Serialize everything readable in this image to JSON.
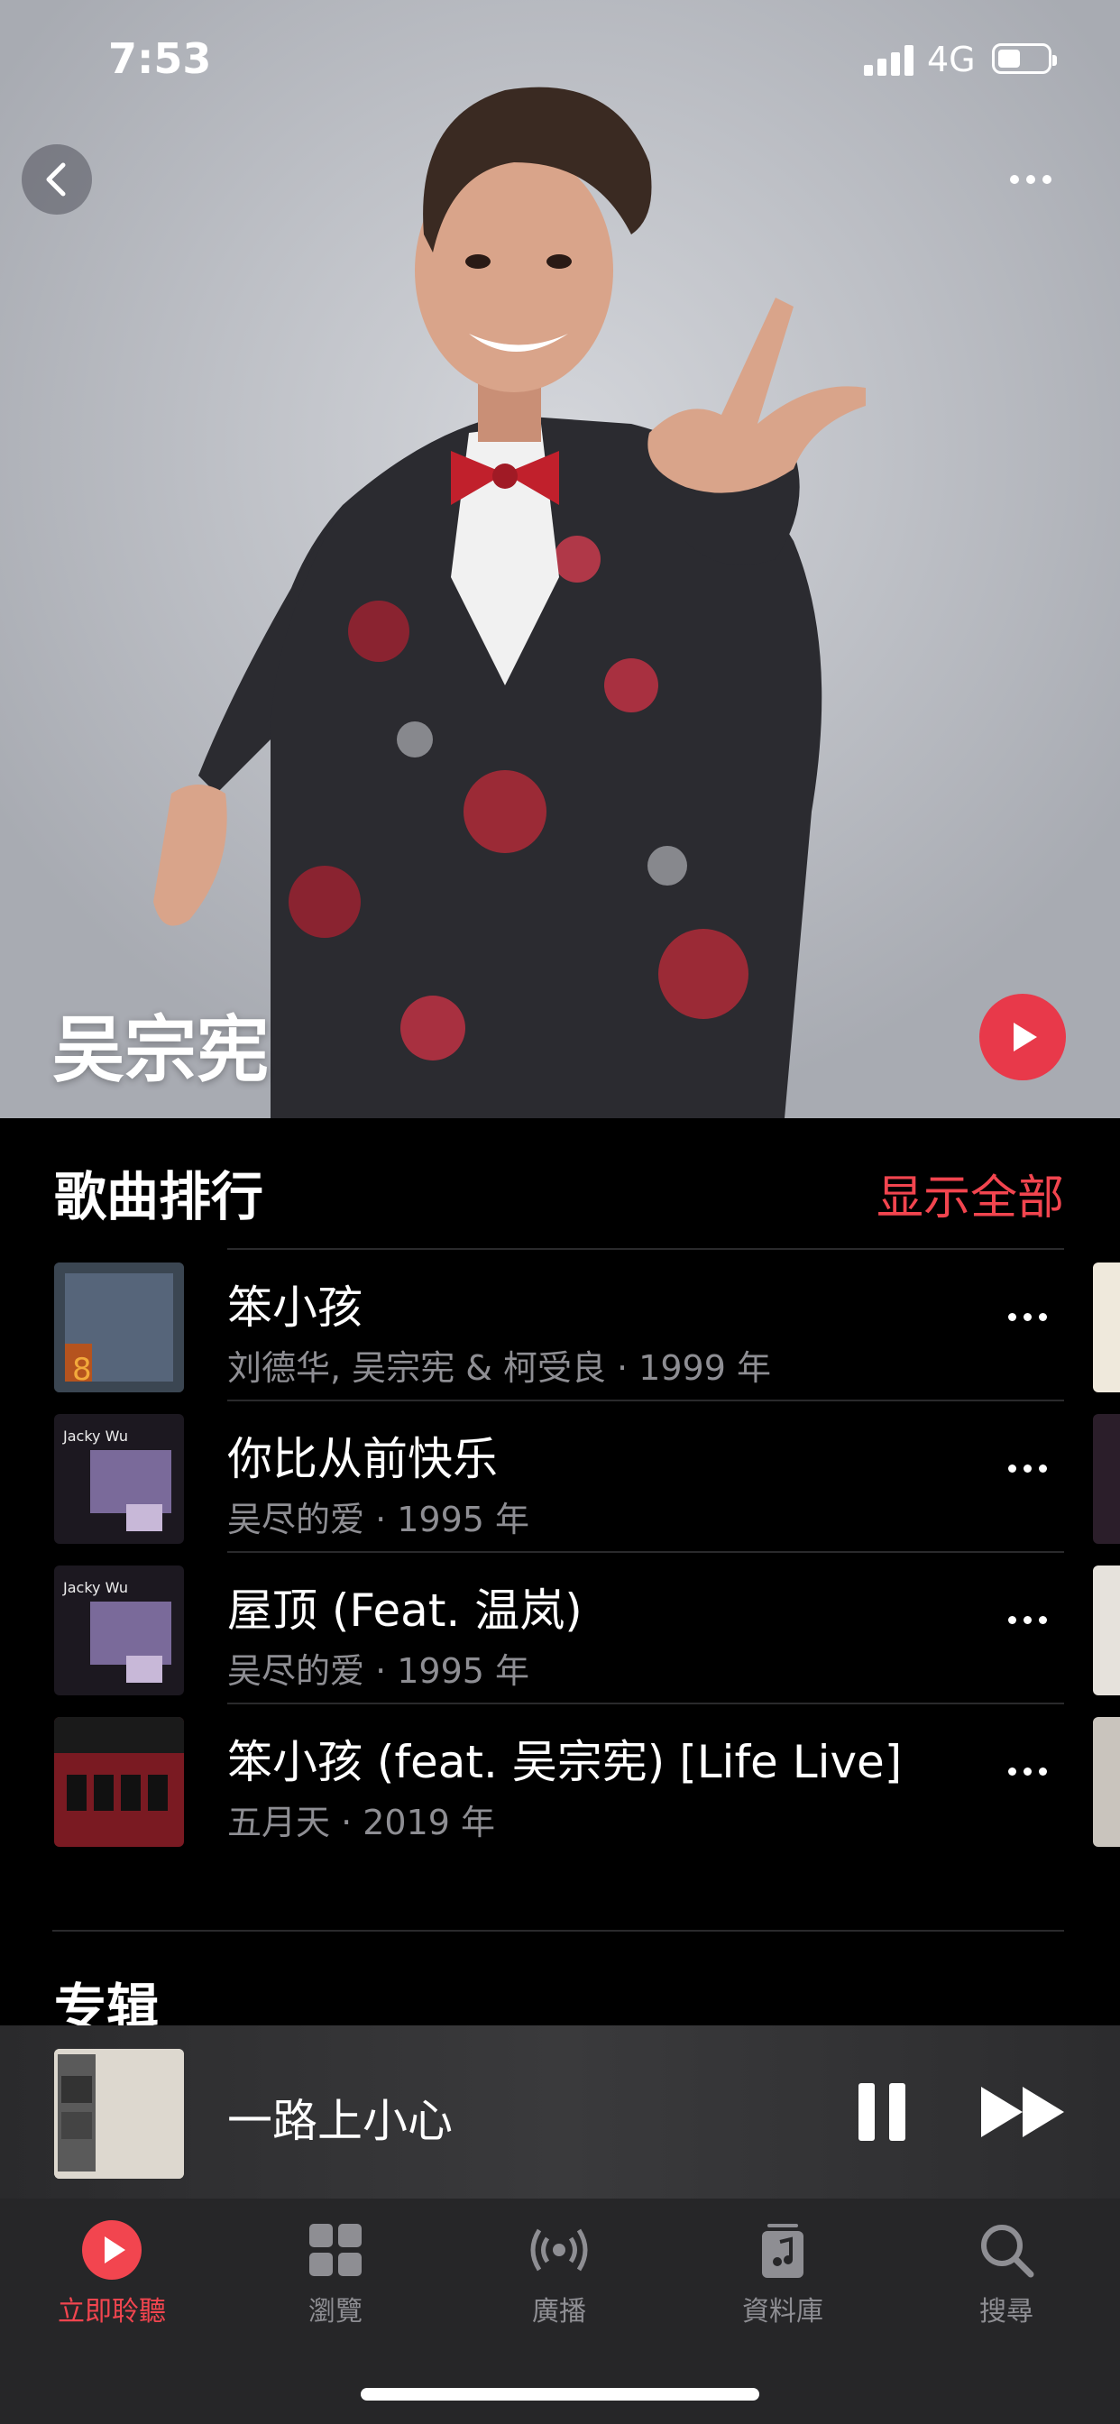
{
  "status_bar": {
    "time": "7:53",
    "network": "4G"
  },
  "hero": {
    "artist_name": "吴宗宪"
  },
  "top_songs": {
    "title": "歌曲排行",
    "show_all": "显示全部",
    "songs": [
      {
        "title": "笨小孩",
        "subtitle": "刘德华, 吴宗宪 & 柯受良 · 1999 年"
      },
      {
        "title": "你比从前快乐",
        "subtitle": "吴尽的爱 · 1995 年"
      },
      {
        "title": "屋顶 (Feat. 温岚)",
        "subtitle": "吴尽的爱 · 1995 年"
      },
      {
        "title": "笨小孩 (feat. 吴宗宪) [Life Live]",
        "subtitle": "五月天 · 2019 年"
      }
    ]
  },
  "albums": {
    "title": "专辑"
  },
  "mini_player": {
    "title": "一路上小心"
  },
  "tabbar": {
    "tabs": [
      {
        "label": "立即聆聽",
        "active": true
      },
      {
        "label": "瀏覽",
        "active": false
      },
      {
        "label": "廣播",
        "active": false
      },
      {
        "label": "資料庫",
        "active": false
      },
      {
        "label": "搜尋",
        "active": false
      }
    ]
  },
  "colors": {
    "accent": "#f2454f",
    "play_button": "#e8394a",
    "background": "#000000",
    "secondary_text": "#8e8e93"
  }
}
